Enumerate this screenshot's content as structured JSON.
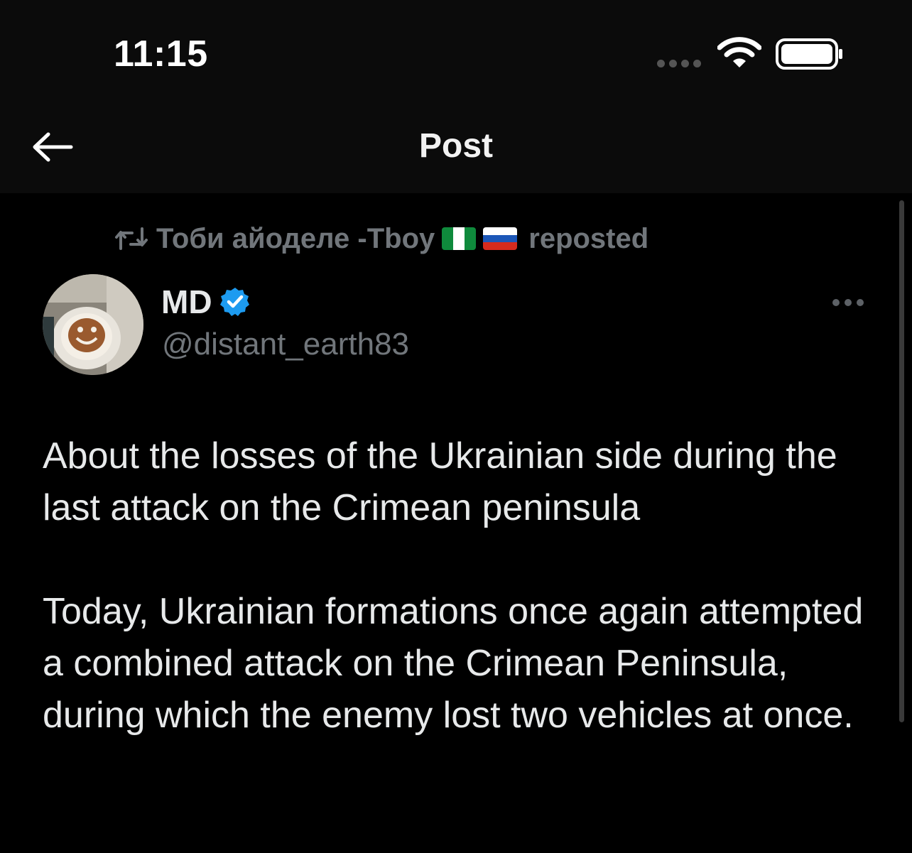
{
  "status_bar": {
    "time": "11:15",
    "signal_icon": "cellular-signal-dots",
    "wifi_icon": "wifi-icon",
    "battery_icon": "battery-icon"
  },
  "header": {
    "back_icon": "arrow-left-icon",
    "title": "Post"
  },
  "repost": {
    "icon": "repost-icon",
    "reposter_name": "Тоби айоделе -Тboy",
    "flags": [
      "nigeria-flag",
      "russia-flag"
    ],
    "label": "reposted"
  },
  "author": {
    "display_name": "MD",
    "verified": true,
    "handle": "@distant_earth83"
  },
  "post": {
    "paragraphs": [
      "About the losses of the Ukrainian side during the last attack on the Crimean peninsula",
      "Today, Ukrainian formations once again attempted a combined attack on the Crimean Peninsula, during which the enemy lost two vehicles at once."
    ]
  },
  "colors": {
    "background": "#000000",
    "bar_background": "#0b0b0b",
    "primary_text": "#e7e9ea",
    "secondary_text": "#71767b",
    "verified_blue": "#1d9bf0"
  }
}
